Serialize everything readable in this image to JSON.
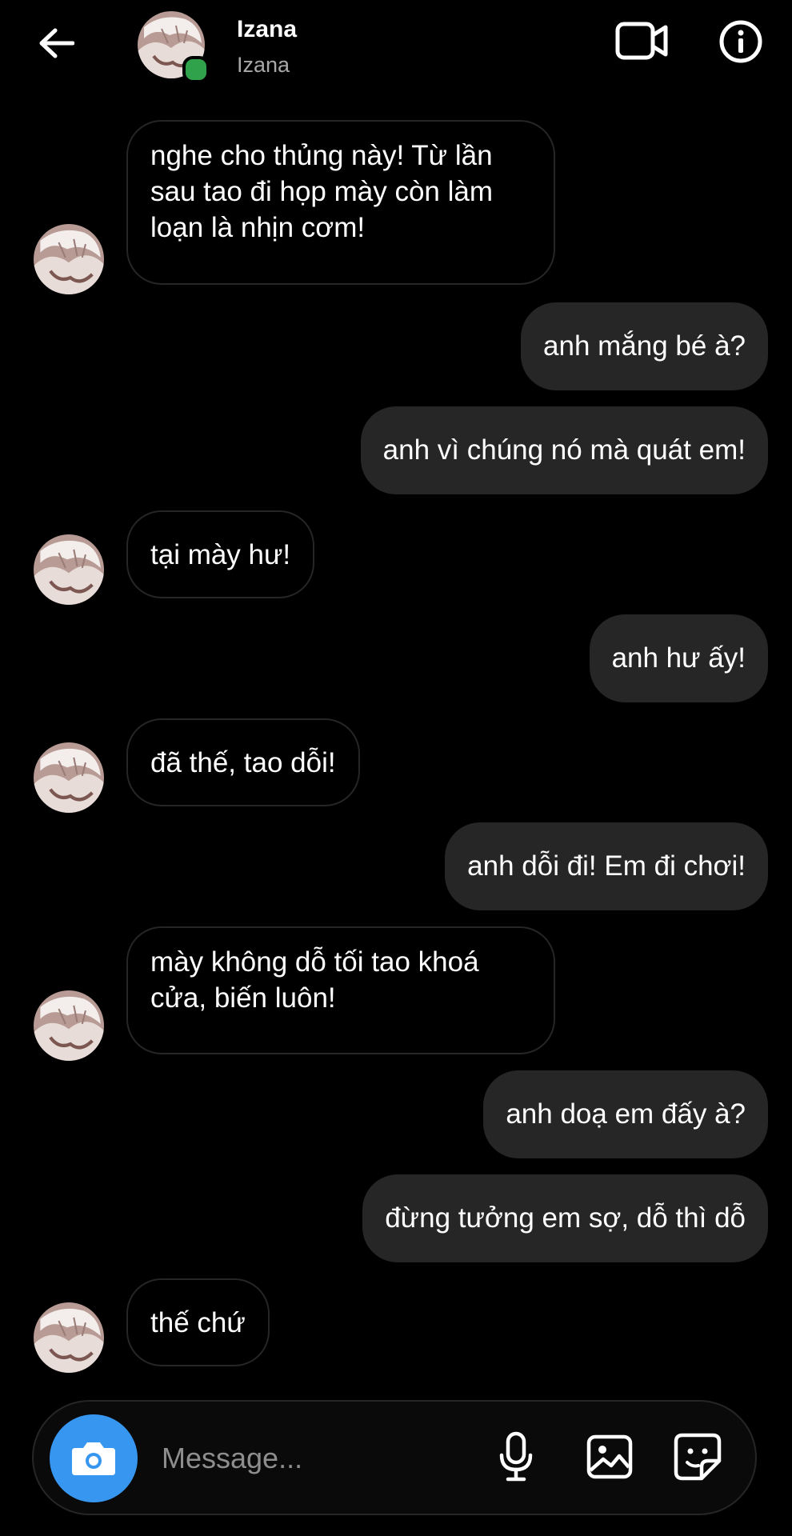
{
  "header": {
    "name": "Izana",
    "subtitle": "Izana",
    "back_icon": "arrow-left-icon",
    "video_icon": "video-camera-icon",
    "info_icon": "info-icon",
    "online_color": "#31a24c"
  },
  "messages": [
    {
      "direction": "in",
      "text": "nghe cho thủng này! Từ lần sau tao đi họp mày còn làm loạn là nhịn cơm!"
    },
    {
      "direction": "out",
      "text": "anh mắng bé à?"
    },
    {
      "direction": "out",
      "text": "anh vì chúng nó mà quát em!"
    },
    {
      "direction": "in",
      "text": "tại mày hư!"
    },
    {
      "direction": "out",
      "text": "anh hư ấy!"
    },
    {
      "direction": "in",
      "text": "đã thế, tao dỗi!"
    },
    {
      "direction": "out",
      "text": "anh dỗi đi! Em đi chơi!"
    },
    {
      "direction": "in",
      "text": "mày không dỗ tối tao khoá cửa, biến luôn!"
    },
    {
      "direction": "out",
      "text": "anh doạ em đấy à?"
    },
    {
      "direction": "out",
      "text": "đừng tưởng em sợ, dỗ thì dỗ"
    },
    {
      "direction": "in",
      "text": "thế chứ"
    }
  ],
  "composer": {
    "placeholder": "Message...",
    "camera_icon": "camera-icon",
    "mic_icon": "microphone-icon",
    "gallery_icon": "image-gallery-icon",
    "sticker_icon": "sticker-icon",
    "accent_color": "#3797f0"
  },
  "colors": {
    "background": "#000000",
    "outgoing_bubble": "#262626",
    "incoming_border": "#262626"
  }
}
